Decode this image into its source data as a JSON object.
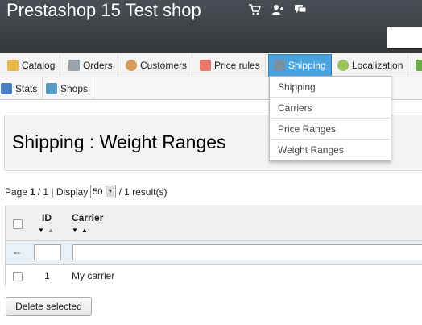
{
  "header": {
    "shop_title": "Prestashop 15 Test shop",
    "icons": [
      "cart-icon",
      "customers-icon",
      "messages-icon"
    ]
  },
  "tabs_row1": [
    {
      "label": "Catalog",
      "icon": "folder-icon",
      "active": false
    },
    {
      "label": "Orders",
      "icon": "cart-icon",
      "active": false
    },
    {
      "label": "Customers",
      "icon": "user-icon",
      "active": false
    },
    {
      "label": "Price rules",
      "icon": "price-tag-icon",
      "active": false
    },
    {
      "label": "Shipping",
      "icon": "truck-icon",
      "active": true
    },
    {
      "label": "Localization",
      "icon": "globe-icon",
      "active": false
    }
  ],
  "tabs_row2": [
    {
      "label": "Stats",
      "icon": "chart-icon"
    },
    {
      "label": "Shops",
      "icon": "home-icon"
    }
  ],
  "dropdown": [
    "Shipping",
    "Carriers",
    "Price Ranges",
    "Weight Ranges"
  ],
  "page_title": "Shipping : Weight Ranges",
  "pagination": {
    "page_label": "Page",
    "page_current": "1",
    "page_total_text": "/ 1 | Display",
    "display_value": "50",
    "results_text": "/ 1 result(s)"
  },
  "table": {
    "columns": [
      "ID",
      "Carrier"
    ],
    "filter_empty_label": "--",
    "rows": [
      {
        "id": "1",
        "carrier": "My carrier"
      }
    ]
  },
  "bulk_button": "Delete selected",
  "colors": {
    "header_bg": "#3a3f45",
    "active_tab": "#4aa3df"
  }
}
